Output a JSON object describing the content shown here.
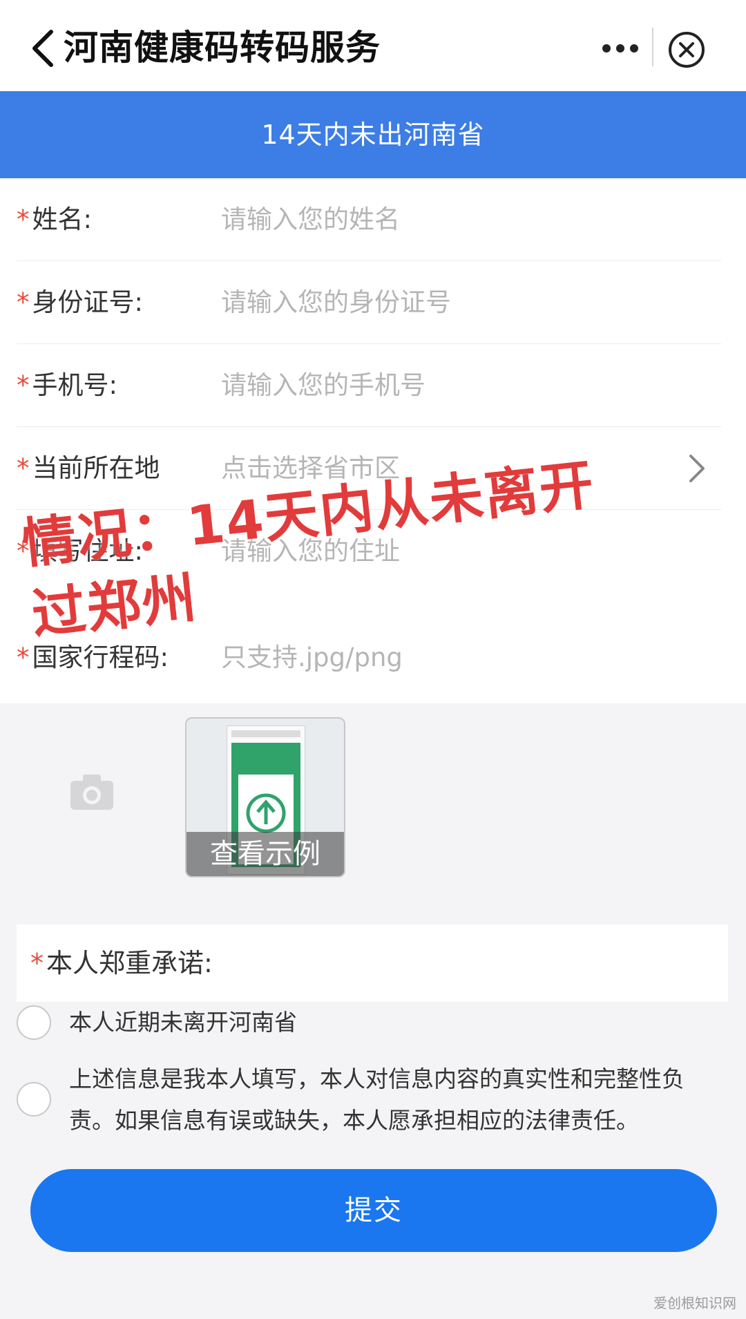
{
  "nav": {
    "title": "河南健康码转码服务"
  },
  "banner": {
    "text": "14天内未出河南省"
  },
  "form": {
    "rows": [
      {
        "label": "姓名:",
        "placeholder": "请输入您的姓名",
        "required": true
      },
      {
        "label": "身份证号:",
        "placeholder": "请输入您的身份证号",
        "required": true
      },
      {
        "label": "手机号:",
        "placeholder": "请输入您的手机号",
        "required": true
      },
      {
        "label": "当前所在地",
        "placeholder": "点击选择省市区",
        "required": true
      },
      {
        "label": "填写住址:",
        "placeholder": "请输入您的住址",
        "required": true
      },
      {
        "label": "国家行程码:",
        "placeholder": "只支持.jpg/png",
        "required": true
      }
    ],
    "star": "*"
  },
  "upload": {
    "sample_label": "查看示例"
  },
  "promise": {
    "label": "本人郑重承诺:",
    "options": [
      "本人近期未离开河南省",
      "上述信息是我本人填写，本人对信息内容的真实性和完整性负",
      "责。如果信息有误或缺失，本人愿承担相应的法律责任。"
    ]
  },
  "submit": {
    "label": "提交"
  },
  "overlay": {
    "line1": "情况：14天内从未离开",
    "line2": "过郑州"
  },
  "watermark": "爱创根知识网",
  "colors": {
    "accent_blue": "#3c7de6",
    "submit_blue": "#1a77f0",
    "required_red": "#e74c3c",
    "overlay_red": "#e23b3b"
  }
}
